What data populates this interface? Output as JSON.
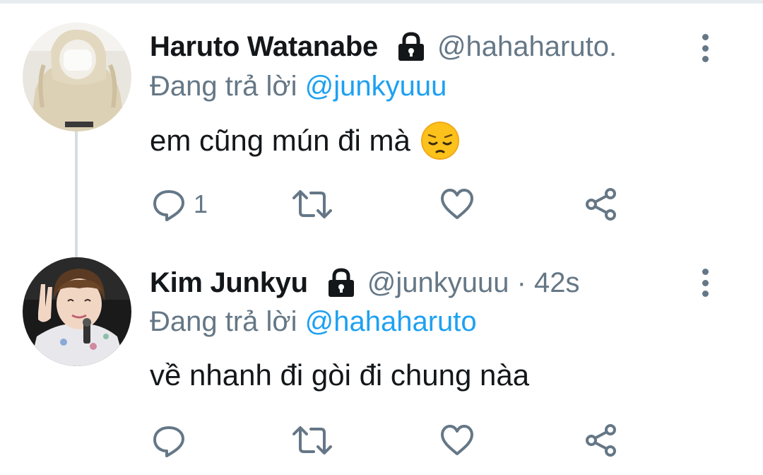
{
  "tweets": [
    {
      "name": "Haruto Watanabe",
      "handle": "@hahaharuto.",
      "replying_prefix": "Đang trả lời ",
      "replying_to": "@junkyuuu",
      "text": "em cũng mún đi mà",
      "emoji": "pensive-face",
      "reply_count": "1",
      "locked": true
    },
    {
      "name": "Kim Junkyu",
      "handle": "@junkyuuu · 42s",
      "replying_prefix": "Đang trả lời ",
      "replying_to": "@hahaharuto",
      "text": "về nhanh đi gòi đi chung nàa",
      "reply_count": "",
      "locked": true
    }
  ],
  "colors": {
    "text": "#14171a",
    "secondary": "#657786",
    "link": "#1da1f2",
    "divider": "#e6ecf0"
  },
  "icons": [
    "lock-icon",
    "more-icon",
    "reply-icon",
    "retweet-icon",
    "like-icon",
    "share-icon"
  ]
}
